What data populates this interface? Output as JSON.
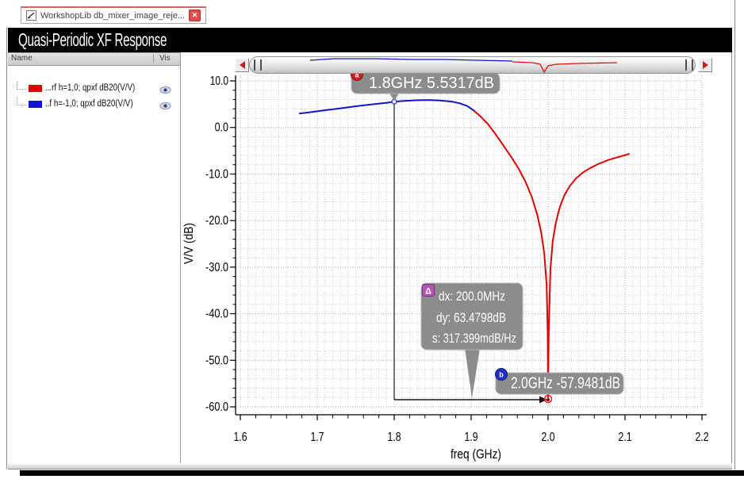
{
  "window": {
    "tab": {
      "title": "WorkshopLib db_mixer_image_reje...",
      "close_label": "✕"
    },
    "title": "Quasi-Periodic XF Response"
  },
  "legend_panel": {
    "name_header": "Name",
    "vis_header": "Vis",
    "items": [
      {
        "color": "#e00000",
        "label": "...rf h=1,0; qpxf dB20(V/V)"
      },
      {
        "color": "#1414cc",
        "label": "..f h=-1,0; qpxf dB20(V/V)"
      }
    ]
  },
  "chart_data": {
    "type": "line",
    "title": "Quasi-Periodic XF Response",
    "xlabel": "freq (GHz)",
    "ylabel": "V/V (dB)",
    "xlim": [
      1.6,
      2.2
    ],
    "ylim": [
      -60,
      10
    ],
    "x_ticks": [
      "1.6",
      "1.7",
      "1.8",
      "1.9",
      "2.0",
      "2.1",
      "2.2"
    ],
    "y_ticks": [
      "10.0",
      "0.0",
      "-10.0",
      "-20.0",
      "-30.0",
      "-40.0",
      "-50.0",
      "-60.0"
    ],
    "grid": {
      "x_minor_step": 0.01,
      "y_minor_step": 2,
      "on": true
    },
    "series": [
      {
        "name": "rf h=1,0; qpxf dB20(V/V)",
        "color": "#e00000",
        "points": [
          [
            1.903,
            3.7
          ],
          [
            1.912,
            2.4
          ],
          [
            1.922,
            0.7
          ],
          [
            1.932,
            -1.5
          ],
          [
            1.942,
            -3.9
          ],
          [
            1.952,
            -6.3
          ],
          [
            1.962,
            -8.9
          ],
          [
            1.971,
            -11.8
          ],
          [
            1.979,
            -15.0
          ],
          [
            1.986,
            -18.8
          ],
          [
            1.991,
            -22.5
          ],
          [
            1.995,
            -27.0
          ],
          [
            1.998,
            -33.5
          ],
          [
            1.9995,
            -44.0
          ],
          [
            2.0,
            -57.9481
          ],
          [
            2.0008,
            -44.0
          ],
          [
            2.003,
            -30.5
          ],
          [
            2.006,
            -24.5
          ],
          [
            2.01,
            -20.5
          ],
          [
            2.015,
            -17.2
          ],
          [
            2.021,
            -14.6
          ],
          [
            2.028,
            -12.6
          ],
          [
            2.036,
            -11.0
          ],
          [
            2.045,
            -9.7
          ],
          [
            2.055,
            -8.7
          ],
          [
            2.066,
            -7.8
          ],
          [
            2.078,
            -7.0
          ],
          [
            2.09,
            -6.4
          ],
          [
            2.1,
            -5.95
          ],
          [
            2.105,
            -5.7
          ]
        ]
      },
      {
        "name": "f h=-1,0; qpxf dB20(V/V)",
        "color": "#1414cc",
        "points": [
          [
            1.677,
            3.0
          ],
          [
            1.69,
            3.25
          ],
          [
            1.71,
            3.7
          ],
          [
            1.73,
            4.1
          ],
          [
            1.75,
            4.55
          ],
          [
            1.77,
            4.95
          ],
          [
            1.79,
            5.3
          ],
          [
            1.8,
            5.5317
          ],
          [
            1.815,
            5.72
          ],
          [
            1.83,
            5.85
          ],
          [
            1.845,
            5.9
          ],
          [
            1.86,
            5.8
          ],
          [
            1.875,
            5.55
          ],
          [
            1.885,
            5.2
          ],
          [
            1.895,
            4.6
          ],
          [
            1.903,
            3.7
          ]
        ]
      }
    ],
    "markers": [
      {
        "id": "a",
        "badge": "a",
        "badge_color": "#cf1f1f",
        "x": 1.8,
        "y": 5.5317,
        "label": "1.8GHz 5.5317dB"
      },
      {
        "id": "b",
        "badge": "b",
        "badge_color": "#2030c8",
        "x": 2.0,
        "y": -57.9481,
        "label": "2.0GHz -57.9481dB"
      }
    ],
    "delta_readout": {
      "badge": "Δ",
      "badge_color": "#b356b3",
      "lines": [
        "dx: 200.0MHz",
        "dy: 63.4798dB",
        "s: 317.399mdB/Hz"
      ]
    }
  },
  "overview": {
    "series": [
      {
        "color": "#1414cc",
        "points": [
          [
            76,
            4
          ],
          [
            106,
            2
          ],
          [
            156,
            2
          ],
          [
            206,
            3
          ],
          [
            246,
            3
          ],
          [
            286,
            4
          ],
          [
            331,
            5
          ]
        ]
      },
      {
        "color": "#dd1111",
        "points": [
          [
            331,
            6
          ],
          [
            356,
            7
          ],
          [
            366,
            9
          ],
          [
            371,
            19
          ],
          [
            376,
            11
          ],
          [
            386,
            9
          ],
          [
            416,
            8
          ],
          [
            463,
            7
          ]
        ]
      }
    ]
  }
}
